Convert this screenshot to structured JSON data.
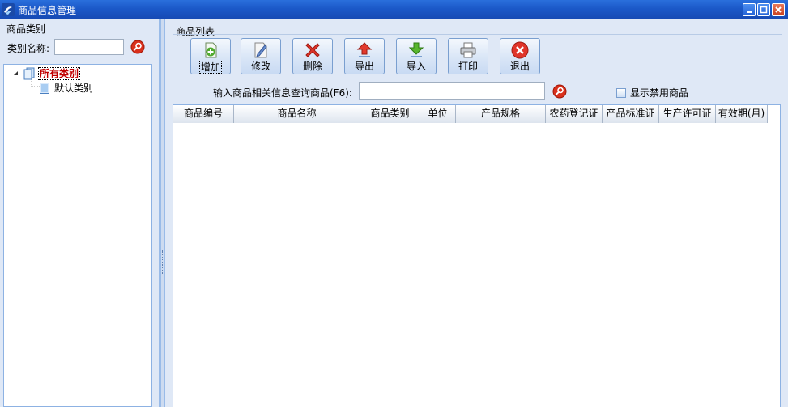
{
  "window": {
    "title": "商品信息管理"
  },
  "left_panel": {
    "header": "商品类别",
    "category_name_label": "类别名称:",
    "category_name_value": "",
    "tree": {
      "root_label": "所有类别",
      "children": [
        "默认类别"
      ]
    }
  },
  "right_panel": {
    "header": "商品列表",
    "toolbar": {
      "buttons": [
        {
          "label": "增加",
          "icon": "add-document-icon"
        },
        {
          "label": "修改",
          "icon": "edit-icon"
        },
        {
          "label": "删除",
          "icon": "delete-x-icon"
        },
        {
          "label": "导出",
          "icon": "export-arrow-up-icon"
        },
        {
          "label": "导入",
          "icon": "import-arrow-down-icon"
        },
        {
          "label": "打印",
          "icon": "printer-icon"
        },
        {
          "label": "退出",
          "icon": "exit-icon"
        }
      ]
    },
    "query": {
      "label": "输入商品相关信息查询商品(F6):",
      "value": ""
    },
    "show_disabled": {
      "label": "显示禁用商品",
      "checked": false
    },
    "grid": {
      "columns": [
        "商品编号",
        "商品名称",
        "商品类别",
        "单位",
        "产品规格",
        "农药登记证",
        "产品标准证",
        "生产许可证",
        "有效期(月)"
      ],
      "rows": []
    }
  },
  "colors": {
    "title_bar": "#1b58c8",
    "panel_bg": "#dfe8f6",
    "border": "#8db2e3",
    "tree_root_text": "#c00000"
  }
}
